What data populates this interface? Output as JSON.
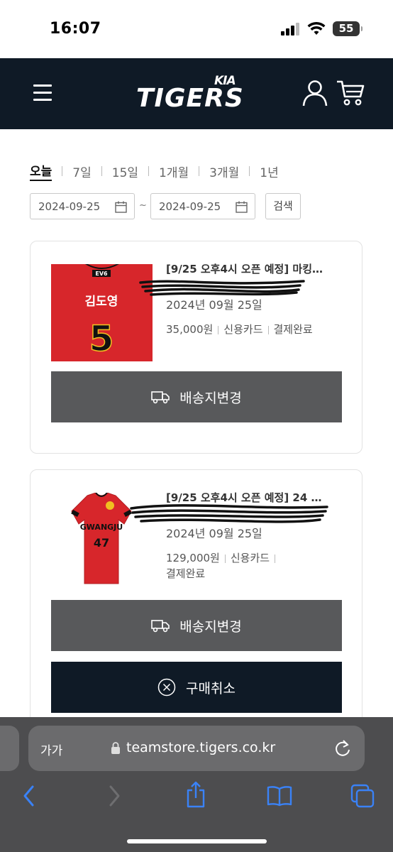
{
  "status_bar": {
    "time": "16:07",
    "battery": "55"
  },
  "header": {
    "logo_top": "KIA",
    "logo_main": "TIGERS"
  },
  "filters": {
    "periods": [
      "오늘",
      "7일",
      "15일",
      "1개월",
      "3개월",
      "1년"
    ],
    "active_period": "오늘",
    "start_date": "2024-09-25",
    "end_date": "2024-09-25",
    "separator": "~",
    "search_label": "검색"
  },
  "orders": [
    {
      "title": "[9/25 오후4시 오픈 예정] 마킹…",
      "date": "2024년 09월 25일",
      "price": "35,000원",
      "payment": "신용카드",
      "status": "결제완료",
      "thumb_name": "김도영",
      "thumb_number": "5",
      "buttons": [
        "배송지변경"
      ]
    },
    {
      "title": "[9/25 오후4시 오픈 예정] 24 …",
      "date": "2024년 09월 25일",
      "price": "129,000원",
      "payment": "신용카드",
      "status": "결제완료",
      "thumb_number": "47",
      "thumb_text": "GWANGJU",
      "buttons": [
        "배송지변경",
        "구매취소"
      ]
    }
  ],
  "browser": {
    "aa_label": "가가",
    "url": "teamstore.tigers.co.kr"
  },
  "colors": {
    "navy": "#0f1a26",
    "gray_button": "#58595b",
    "jersey_red": "#d7262b"
  }
}
